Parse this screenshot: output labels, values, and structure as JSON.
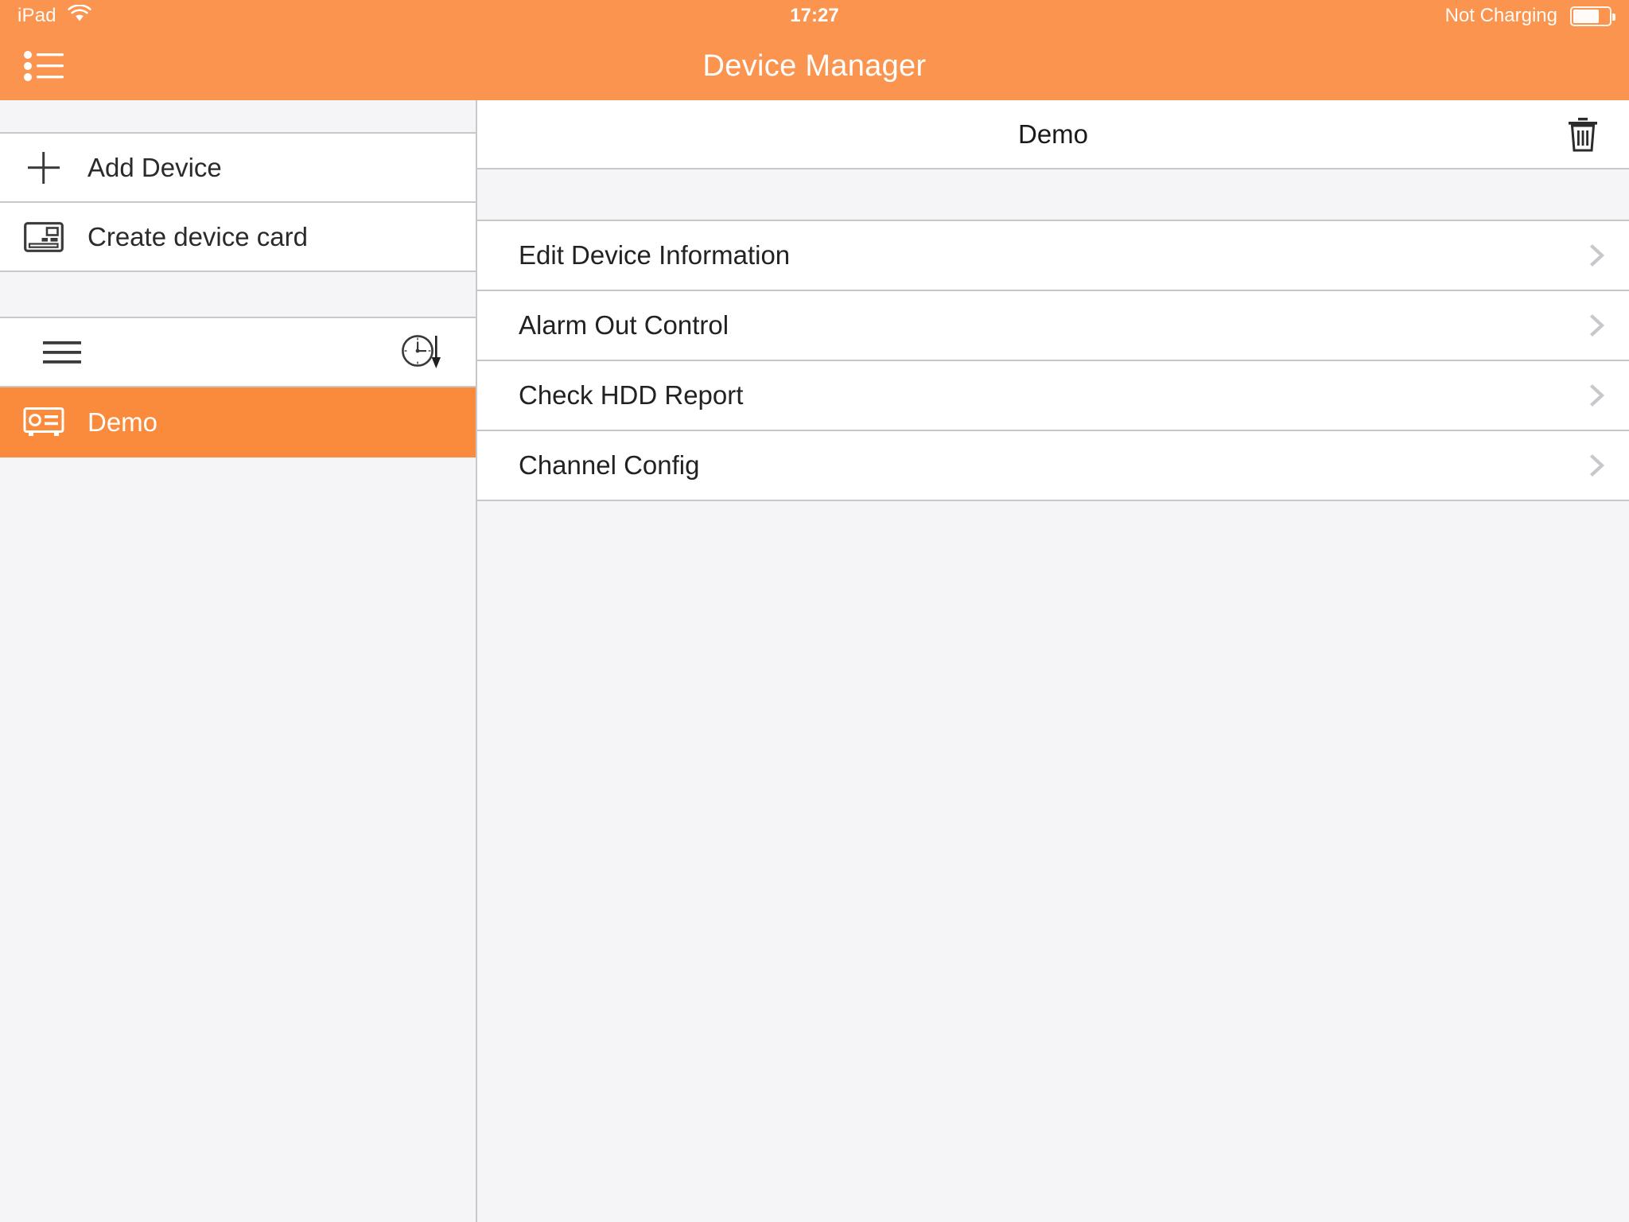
{
  "colors": {
    "accent": "#FB944E",
    "accent_selected": "#FB8B3C",
    "panel_bg": "#F5F5F7",
    "divider": "#C8C7CC",
    "text": "#222222",
    "chevron": "#C7C7CC"
  },
  "status_bar": {
    "device_label": "iPad",
    "wifi_icon": "wifi-icon",
    "time": "17:27",
    "battery_text": "Not Charging",
    "battery_icon": "battery-icon",
    "battery_level_percent": 66
  },
  "nav_bar": {
    "menu_icon": "bulleted-list-icon",
    "title": "Device Manager"
  },
  "sidebar": {
    "items": [
      {
        "label": "Add Device",
        "icon": "plus-icon"
      },
      {
        "label": "Create device card",
        "icon": "device-card-icon"
      }
    ],
    "toolbar": {
      "left_icon": "hamburger-menu-icon",
      "right_icon": "clock-download-icon"
    },
    "devices": [
      {
        "label": "Demo",
        "icon": "nvr-device-icon",
        "selected": true
      }
    ]
  },
  "main": {
    "header": {
      "title": "Demo",
      "delete_icon": "trash-icon"
    },
    "menu_items": [
      {
        "label": "Edit Device Information",
        "chevron": "chevron-right-icon"
      },
      {
        "label": "Alarm Out Control",
        "chevron": "chevron-right-icon"
      },
      {
        "label": "Check HDD Report",
        "chevron": "chevron-right-icon"
      },
      {
        "label": "Channel Config",
        "chevron": "chevron-right-icon"
      }
    ]
  }
}
